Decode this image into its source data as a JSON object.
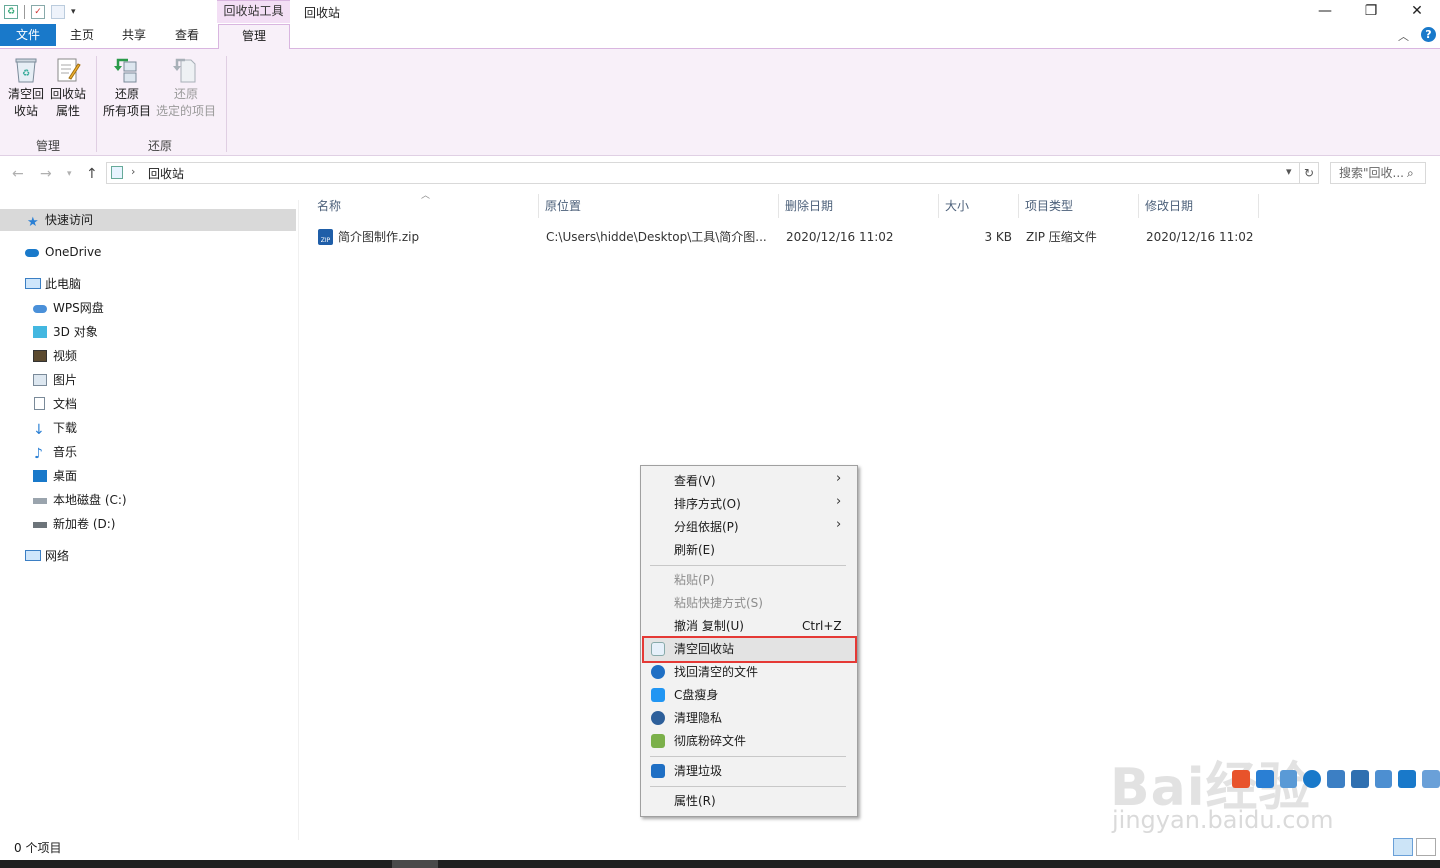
{
  "window": {
    "context_group": "回收站工具",
    "title": "回收站",
    "controls": {
      "minimize": "—",
      "maximize": "❐",
      "close": "✕"
    }
  },
  "tabs": {
    "file": "文件",
    "home": "主页",
    "share": "共享",
    "view": "查看",
    "manage": "管理"
  },
  "ribbon": {
    "empty_bin": [
      "清空回",
      "收站"
    ],
    "bin_props": [
      "回收站",
      "属性"
    ],
    "restore_all": [
      "还原",
      "所有项目"
    ],
    "restore_selected": [
      "还原",
      "选定的项目"
    ],
    "group_manage": "管理",
    "group_restore": "还原"
  },
  "address": {
    "path": "回收站",
    "search_placeholder": "搜索\"回收..."
  },
  "nav": {
    "quick_access": "快速访问",
    "onedrive": "OneDrive",
    "this_pc": "此电脑",
    "wps": "WPS网盘",
    "objects3d": "3D 对象",
    "videos": "视频",
    "pictures": "图片",
    "documents": "文档",
    "downloads": "下载",
    "music": "音乐",
    "desktop": "桌面",
    "drive_c": "本地磁盘 (C:)",
    "drive_d": "新加卷 (D:)",
    "network": "网络"
  },
  "columns": [
    "名称",
    "原位置",
    "删除日期",
    "大小",
    "项目类型",
    "修改日期"
  ],
  "files": [
    {
      "name": "简介图制作.zip",
      "location": "C:\\Users\\hidde\\Desktop\\工具\\简介图...",
      "deleted": "2020/12/16 11:02",
      "size": "3 KB",
      "type": "ZIP 压缩文件",
      "modified": "2020/12/16 11:02"
    }
  ],
  "menu": {
    "view": "查看(V)",
    "sort": "排序方式(O)",
    "group": "分组依据(P)",
    "refresh": "刷新(E)",
    "paste": "粘贴(P)",
    "paste_shortcut": "粘贴快捷方式(S)",
    "undo": "撤消 复制(U)",
    "undo_shortcut": "Ctrl+Z",
    "empty_bin": "清空回收站",
    "recover": "找回清空的文件",
    "slim_c": "C盘瘦身",
    "privacy": "清理隐私",
    "shred": "彻底粉碎文件",
    "cleanup": "清理垃圾",
    "properties": "属性(R)"
  },
  "status": {
    "count": "0 个项目"
  },
  "watermark": {
    "brand": "Bai经验",
    "url": "jingyan.baidu.com"
  },
  "colors": {
    "accent": "#1979ca",
    "context_tab": "#f3dff5",
    "highlight_border": "#e53935"
  }
}
